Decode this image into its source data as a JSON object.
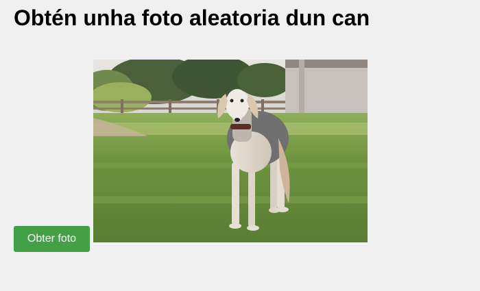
{
  "page": {
    "title": "Obtén unha foto aleatoria dun can"
  },
  "controls": {
    "get_photo_label": "Obter foto"
  },
  "photo": {
    "subject": "dog-photo"
  },
  "colors": {
    "background": "#f0f0f0",
    "button": "#43a047",
    "button_text": "#ffffff",
    "title": "#000000"
  }
}
